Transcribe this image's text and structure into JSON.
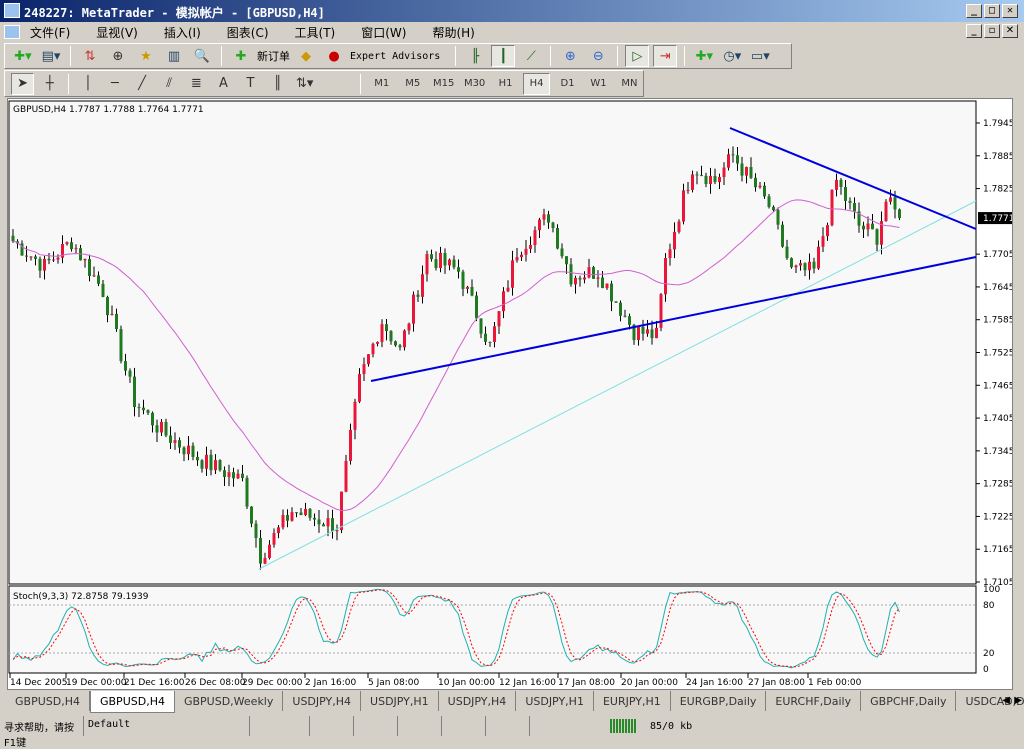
{
  "window": {
    "title": "248227: MetaTrader - 模拟帐户 - [GBPUSD,H4]"
  },
  "menu": [
    "文件(F)",
    "显视(V)",
    "插入(I)",
    "图表(C)",
    "工具(T)",
    "窗口(W)",
    "帮助(H)"
  ],
  "toolbar": {
    "new_order": "新订单",
    "expert_advisors": "Expert Advisors"
  },
  "timeframes": [
    "M1",
    "M5",
    "M15",
    "M30",
    "H1",
    "H4",
    "D1",
    "W1",
    "MN"
  ],
  "active_timeframe": "H4",
  "chart": {
    "header": "GBPUSD,H4  1.7787 1.7788 1.7764 1.7771",
    "current_price": "1.7771",
    "price_labels": [
      "1.7945",
      "1.7885",
      "1.7825",
      "1.7705",
      "1.7645",
      "1.7585",
      "1.7525",
      "1.7465",
      "1.7405",
      "1.7345",
      "1.7285",
      "1.7225",
      "1.7165",
      "1.7105"
    ],
    "stoch_header": "Stoch(9,3,3) 72.8758 79.1939",
    "stoch_labels": [
      "100",
      "80",
      "20",
      "0"
    ],
    "time_labels": [
      "14 Dec 2005",
      "19 Dec 00:00",
      "21 Dec 16:00",
      "26 Dec 08:00",
      "29 Dec 00:00",
      "2 Jan 16:00",
      "5 Jan 08:00",
      "10 Jan 00:00",
      "12 Jan 16:00",
      "17 Jan 08:00",
      "20 Jan 00:00",
      "24 Jan 16:00",
      "27 Jan 08:00",
      "1 Feb 00:00"
    ],
    "colors": {
      "bull": "#e8173a",
      "bear": "#1f7a1f",
      "ma": "#d060d0",
      "trend": "#0000dd",
      "trend2": "#80e0e0",
      "stoch_main": "#20b0b0",
      "stoch_signal": "#ff0000"
    }
  },
  "chart_data": {
    "type": "candlestick",
    "symbol": "GBPUSD",
    "timeframe": "H4",
    "ylim": [
      1.7105,
      1.7945
    ],
    "close_keypoints": [
      [
        0,
        1.7729
      ],
      [
        7,
        1.7683
      ],
      [
        13,
        1.7729
      ],
      [
        20,
        1.7638
      ],
      [
        27,
        1.7436
      ],
      [
        33,
        1.7381
      ],
      [
        42,
        1.7327
      ],
      [
        51,
        1.729
      ],
      [
        55,
        1.7153
      ],
      [
        62,
        1.7235
      ],
      [
        72,
        1.7208
      ],
      [
        77,
        1.7473
      ],
      [
        82,
        1.7583
      ],
      [
        86,
        1.7528
      ],
      [
        92,
        1.7702
      ],
      [
        99,
        1.7674
      ],
      [
        106,
        1.7537
      ],
      [
        112,
        1.7711
      ],
      [
        119,
        1.7775
      ],
      [
        124,
        1.7665
      ],
      [
        130,
        1.7674
      ],
      [
        138,
        1.7565
      ],
      [
        143,
        1.7555
      ],
      [
        145,
        1.7693
      ],
      [
        151,
        1.7866
      ],
      [
        156,
        1.7839
      ],
      [
        160,
        1.7885
      ],
      [
        168,
        1.7793
      ],
      [
        173,
        1.7674
      ],
      [
        178,
        1.7674
      ],
      [
        183,
        1.7839
      ],
      [
        188,
        1.7757
      ],
      [
        192,
        1.7738
      ],
      [
        194,
        1.7802
      ],
      [
        197,
        1.7771
      ]
    ]
  },
  "tabs": [
    "GBPUSD,H4",
    "GBPUSD,H4",
    "GBPUSD,Weekly",
    "USDJPY,H4",
    "USDJPY,H1",
    "USDJPY,H4",
    "USDJPY,H1",
    "EURJPY,H1",
    "EURGBP,Daily",
    "EURCHF,Daily",
    "GBPCHF,Daily",
    "USDCAD,Dai"
  ],
  "active_tab": 1,
  "status": {
    "help": "寻求帮助，请按F1键",
    "profile": "Default",
    "traffic": "85/0 kb"
  }
}
